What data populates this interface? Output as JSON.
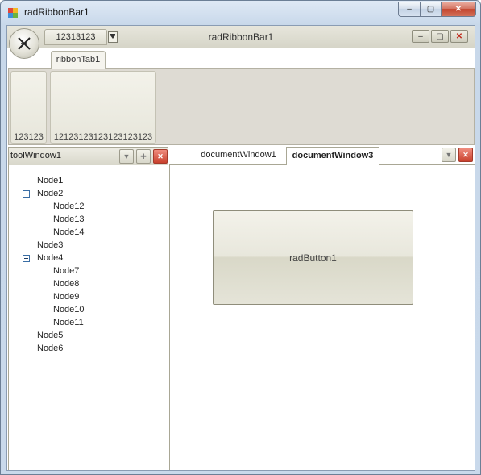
{
  "window": {
    "title": "radRibbonBar1",
    "controls": {
      "minimize": "–",
      "maximize": "▢",
      "close": "✕"
    }
  },
  "ribbon": {
    "title": "radRibbonBar1",
    "qat_tab_label": "12313123",
    "tabs": [
      {
        "label": "ribbonTab1",
        "selected": true
      }
    ],
    "groups": [
      {
        "label": "123123"
      },
      {
        "label": "12123123123123123123"
      }
    ],
    "controls": {
      "minimize": "–",
      "maximize": "▢",
      "close": "✕"
    }
  },
  "tool_window": {
    "title": "toolWindow1",
    "buttons": {
      "dropdown": "▼",
      "pin": "✚",
      "close": "✕"
    },
    "tree": [
      {
        "label": "Node1",
        "level": 0,
        "expanded": false,
        "has_children": false
      },
      {
        "label": "Node2",
        "level": 0,
        "expanded": true,
        "has_children": true
      },
      {
        "label": "Node12",
        "level": 1
      },
      {
        "label": "Node13",
        "level": 1
      },
      {
        "label": "Node14",
        "level": 1
      },
      {
        "label": "Node3",
        "level": 0,
        "has_children": false
      },
      {
        "label": "Node4",
        "level": 0,
        "expanded": true,
        "has_children": true
      },
      {
        "label": "Node7",
        "level": 1
      },
      {
        "label": "Node8",
        "level": 1
      },
      {
        "label": "Node9",
        "level": 1
      },
      {
        "label": "Node10",
        "level": 1
      },
      {
        "label": "Node11",
        "level": 1
      },
      {
        "label": "Node5",
        "level": 0,
        "has_children": false
      },
      {
        "label": "Node6",
        "level": 0,
        "has_children": false
      }
    ]
  },
  "document": {
    "tabs": [
      {
        "label": "documentWindow1",
        "active": false
      },
      {
        "label": "documentWindow3",
        "active": true
      }
    ],
    "buttons": {
      "dropdown": "▼",
      "close": "✕"
    },
    "button_label": "radButton1"
  },
  "colors": {
    "ribbon_panel": "#dedbd3",
    "close_red": "#c9412d",
    "tree_expander_blue": "#3a6ea5"
  }
}
